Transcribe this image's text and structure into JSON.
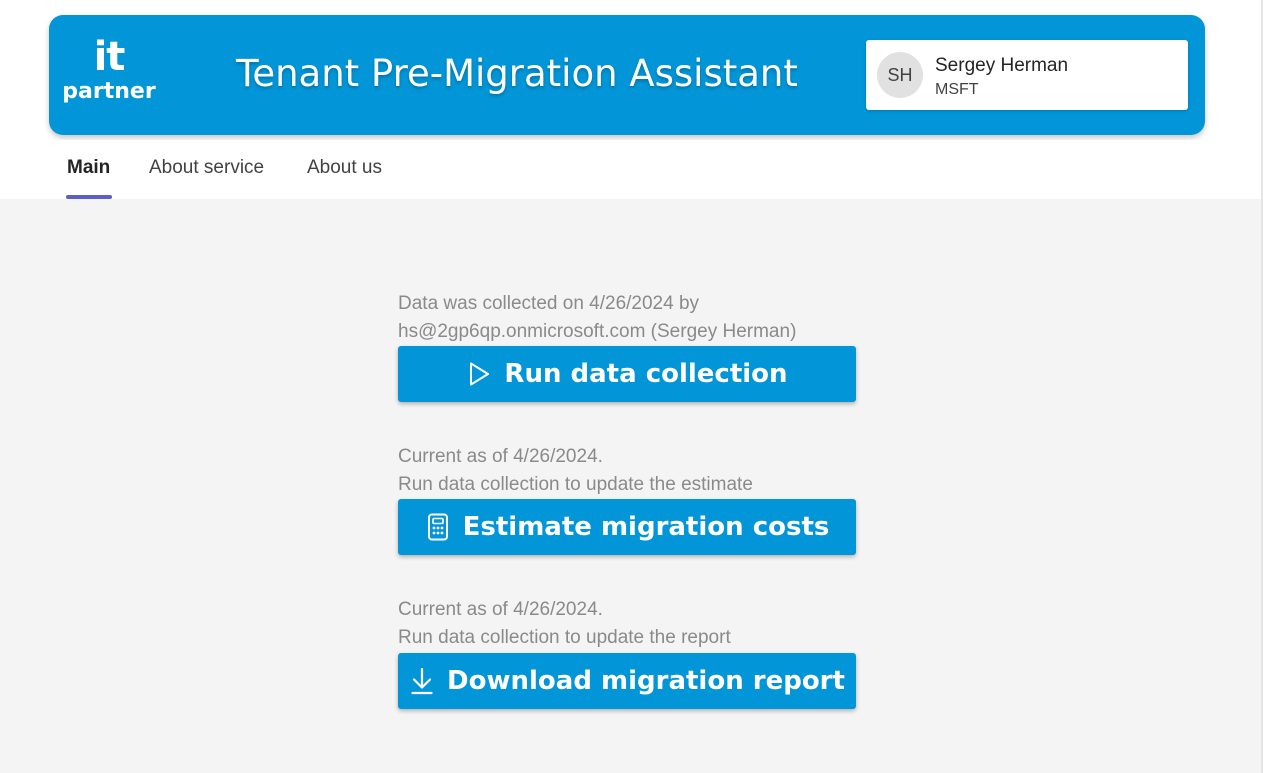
{
  "header": {
    "logo": {
      "line1": "it",
      "line2": "partner"
    },
    "title": "Tenant Pre-Migration Assistant",
    "user": {
      "initials": "SH",
      "name": "Sergey Herman",
      "org": "MSFT"
    }
  },
  "tabs": [
    {
      "label": "Main",
      "active": true
    },
    {
      "label": "About service",
      "active": false
    },
    {
      "label": "About us",
      "active": false
    }
  ],
  "actions": [
    {
      "info_line1": "Data was collected on 4/26/2024 by",
      "info_line2": "hs@2gp6qp.onmicrosoft.com (Sergey Herman)",
      "label": "Run data collection",
      "icon": "play-icon"
    },
    {
      "info_line1": "Current as of 4/26/2024.",
      "info_line2": "Run data collection to update the estimate",
      "label": "Estimate migration costs",
      "icon": "calculator-icon"
    },
    {
      "info_line1": "Current as of 4/26/2024.",
      "info_line2": "Run data collection to update the report",
      "label": "Download migration report",
      "icon": "download-icon"
    }
  ],
  "colors": {
    "brand_blue": "#0296d8",
    "tab_indicator": "#5b5fc7",
    "content_background": "#f4f4f4",
    "info_text": "#8a8a8a"
  }
}
